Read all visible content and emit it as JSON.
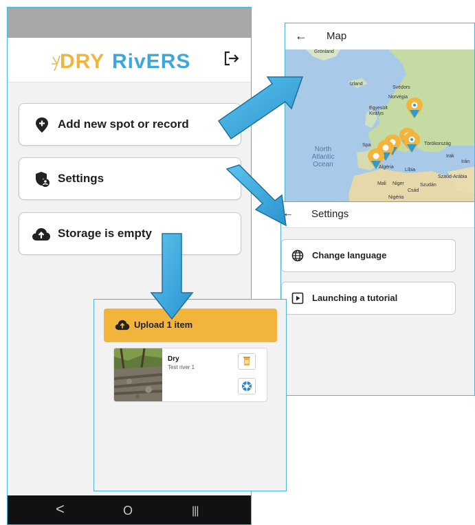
{
  "main_phone": {
    "logo_text": "DRYRivERS",
    "buttons": [
      {
        "label": "Add new spot or record",
        "icon": "location-plus-icon"
      },
      {
        "label": "Settings",
        "icon": "shield-user-icon"
      },
      {
        "label": "Storage is empty",
        "icon": "cloud-upload-icon"
      }
    ],
    "nav": {
      "back": "<",
      "home": "O",
      "recents": "|||"
    }
  },
  "map_screen": {
    "back_glyph": "←",
    "title": "Map",
    "labels": {
      "greenland": "Grönland",
      "iceland": "Izland",
      "sweden": "Svédors",
      "norway": "Norvégia",
      "uk": "Egyesült Királys",
      "spain": "Spa",
      "turkey": "Törökország",
      "iraq": "Irak",
      "iran": "Irán",
      "algeria": "Algéria",
      "libya": "Líbia",
      "saudi": "Szaúd-Arábia",
      "mali": "Mali",
      "niger": "Niger",
      "sudan": "Szudán",
      "chad": "Csád",
      "nigeria": "Nigéria",
      "ocean_1": "North",
      "ocean_2": "Atlantic",
      "ocean_3": "Ocean"
    }
  },
  "settings_screen": {
    "back_glyph": "←",
    "title": "Settings",
    "items": [
      {
        "label": "Change language",
        "icon": "globe-icon"
      },
      {
        "label": "Launching a tutorial",
        "icon": "play-box-icon"
      }
    ]
  },
  "storage_screen": {
    "upload_label": "Upload 1 item",
    "item": {
      "status": "Dry",
      "name": "Test river 1"
    }
  },
  "colors": {
    "accent": "#f2b43a",
    "arrow": "#3aa8dc",
    "frame": "#4ab3d8"
  }
}
